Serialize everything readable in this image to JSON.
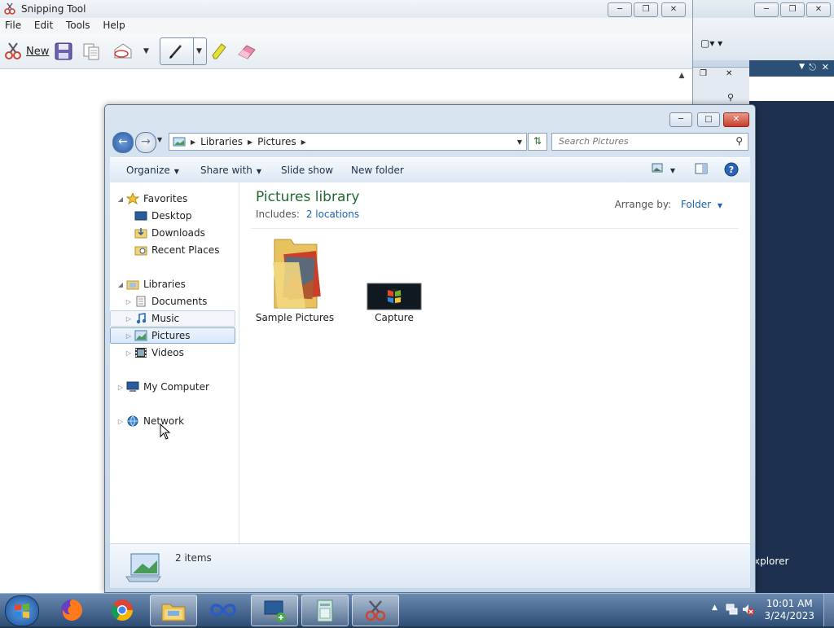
{
  "snipping_tool": {
    "title": "Snipping Tool",
    "menu": [
      "File",
      "Edit",
      "Tools",
      "Help"
    ],
    "new_label": "New"
  },
  "background_window": {
    "partial_label": "xplorer"
  },
  "explorer": {
    "breadcrumbs": [
      "Libraries",
      "Pictures"
    ],
    "search_placeholder": "Search Pictures",
    "commands": {
      "organize": "Organize",
      "share_with": "Share with",
      "slide_show": "Slide show",
      "new_folder": "New folder"
    },
    "nav": {
      "favorites": "Favorites",
      "desktop": "Desktop",
      "downloads": "Downloads",
      "recent_places": "Recent Places",
      "libraries": "Libraries",
      "documents": "Documents",
      "music": "Music",
      "pictures": "Pictures",
      "videos": "Videos",
      "my_computer": "My Computer",
      "network": "Network"
    },
    "library": {
      "title": "Pictures library",
      "includes_label": "Includes:",
      "locations_link": "2 locations",
      "arrange_label": "Arrange by:",
      "arrange_value": "Folder"
    },
    "items": [
      {
        "label": "Sample Pictures"
      },
      {
        "label": "Capture"
      }
    ],
    "details": {
      "count": "2 items"
    }
  },
  "taskbar": {
    "time": "10:01 AM",
    "date": "3/24/2023"
  },
  "colors": {
    "library_title": "#1f6a2e",
    "link": "#1a63b8",
    "taskbar": "#2d4d76"
  }
}
